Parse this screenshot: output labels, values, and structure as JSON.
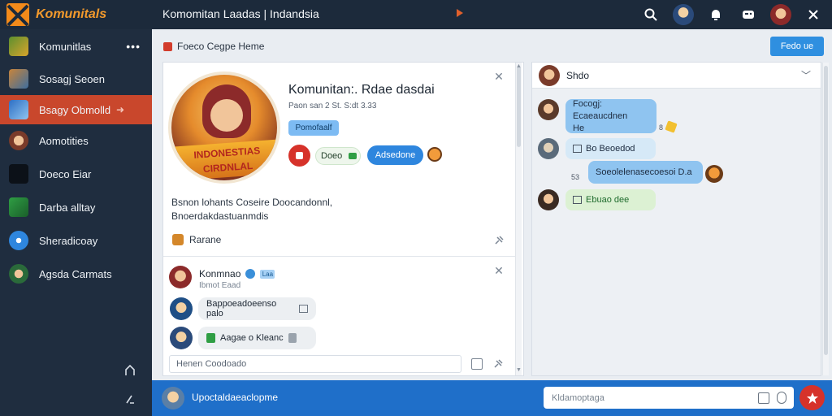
{
  "app": {
    "brand": "Komunitals",
    "window_title": "Komomitan  Laadas | Indandsia",
    "brand_color": "#f28a1a"
  },
  "topbar": {
    "icons": [
      "search-icon",
      "avatar",
      "notification-bell-icon",
      "gamepad-icon",
      "avatar",
      "close-icon"
    ]
  },
  "sidebar": {
    "items": [
      {
        "label": "Komunitlas",
        "icon": "community-icon"
      },
      {
        "label": "Sosagj Seoen",
        "icon": "game-icon"
      },
      {
        "label": "Bsagy Obmolld",
        "icon": "game-icon"
      },
      {
        "label": "Aomotities",
        "icon": "game-icon"
      },
      {
        "label": "Doeco Eiar",
        "icon": "game-icon"
      },
      {
        "label": "Darba alltay",
        "icon": "game-icon"
      },
      {
        "label": "Sheradicoay",
        "icon": "compass-icon"
      },
      {
        "label": "Agsda Carmats",
        "icon": "game-icon"
      }
    ],
    "more_label": "•••",
    "active_index": 2
  },
  "main": {
    "breadcrumb": "Foeco  Cegpe   Heme",
    "primary_button": "Fedo ue"
  },
  "game": {
    "banner_text": "INDONESTIAS CIRDNLAL",
    "title": "Komunitan:. Rdae dasdai",
    "meta": "Paon san 2 St. S:dt 3.33",
    "badge": "Pomofaalf",
    "pill_label": "Doeo",
    "join_button": "Adsedone",
    "description": "Bsnon lohants Coseire Doocandonnl,\nBnoerdakdastuanmdis",
    "footer_label": "Rarane"
  },
  "comments": {
    "author": "Konmnao",
    "tag": "Laa",
    "time": "Ibmot   Eaad",
    "messages": [
      {
        "text": "Bappoeadoeenso palo"
      },
      {
        "text": "Aagae o Kleanc"
      }
    ],
    "input_placeholder": "Henen  Coodoado"
  },
  "chat": {
    "header_name": "Shdo",
    "messages": [
      {
        "text": "Focogj: Ecaeaucdnen\nHe",
        "side": "left",
        "time": "8"
      },
      {
        "text": "Bo  Beoedod",
        "side": "left"
      },
      {
        "text": "Soeolelenasecoesoi D.a",
        "side": "right",
        "time": "53"
      },
      {
        "text": "Ebuao dee",
        "side": "left"
      }
    ]
  },
  "bottombar": {
    "user_label": "Upoctaldaeaclopme",
    "input_placeholder": "Kldamoptaga"
  }
}
